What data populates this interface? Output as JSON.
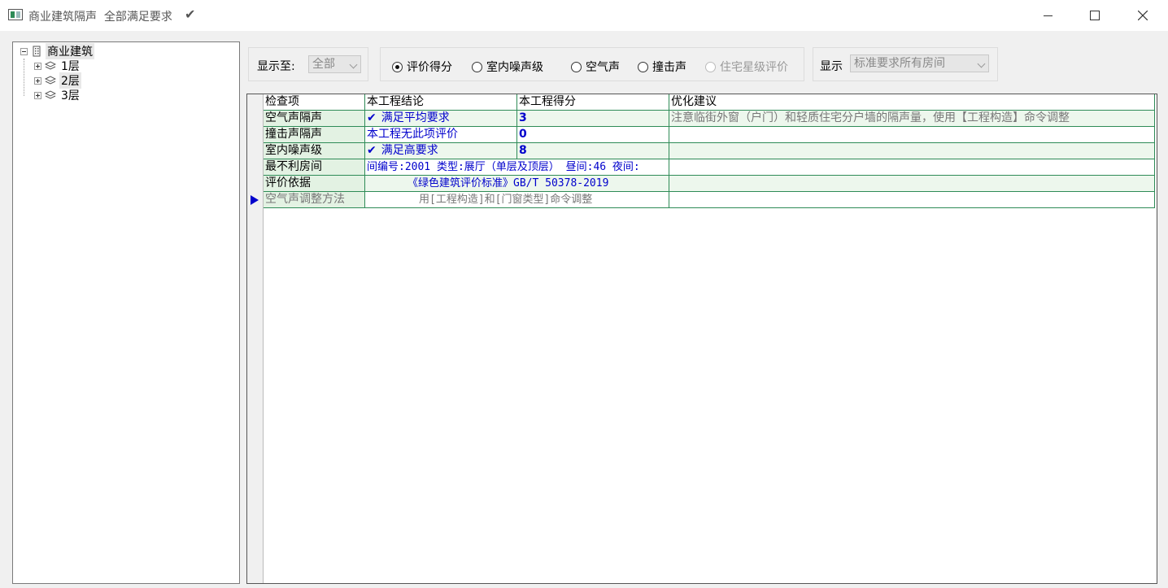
{
  "window": {
    "title": "商业建筑隔声  全部满足要求",
    "title_check_icon": "check-icon"
  },
  "tree": {
    "root": "商业建筑",
    "children": [
      "1层",
      "2层",
      "3层"
    ]
  },
  "filters": {
    "show_to_label": "显示至:",
    "show_to_value": "全部",
    "radios": [
      {
        "label": "评价得分",
        "selected": true,
        "enabled": true
      },
      {
        "label": "室内噪声级",
        "selected": false,
        "enabled": true
      },
      {
        "label": "空气声",
        "selected": false,
        "enabled": true
      },
      {
        "label": "撞击声",
        "selected": false,
        "enabled": true
      },
      {
        "label": "住宅星级评价",
        "selected": false,
        "enabled": false
      }
    ],
    "display_label": "显示",
    "display_value": "标准要求所有房间"
  },
  "grid": {
    "headers": [
      "检查项",
      "本工程结论",
      "本工程得分",
      "优化建议"
    ],
    "rows": [
      {
        "item": "空气声隔声",
        "conclusion": "满足平均要求",
        "score": "3",
        "advice": "注意临街外窗（户门）和轻质住宅分户墙的隔声量，使用【工程构造】命令调整"
      },
      {
        "item": "撞击声隔声",
        "conclusion": "本工程无此项评价",
        "score": "0",
        "advice": ""
      },
      {
        "item": "室内噪声级",
        "conclusion": "满足高要求",
        "score": "8",
        "advice": ""
      },
      {
        "item": "最不利房间",
        "conclusion": "间编号:2001 类型:展厅（单层及顶层） 昼间:46 夜间:",
        "score": "",
        "advice": ""
      },
      {
        "item": "评价依据",
        "conclusion": "《绿色建筑评价标准》GB/T 50378-2019",
        "score": "",
        "advice": ""
      },
      {
        "item": "空气声调整方法",
        "conclusion": "用[工程构造]和[门窗类型]命令调整",
        "score": "",
        "advice": ""
      }
    ]
  }
}
